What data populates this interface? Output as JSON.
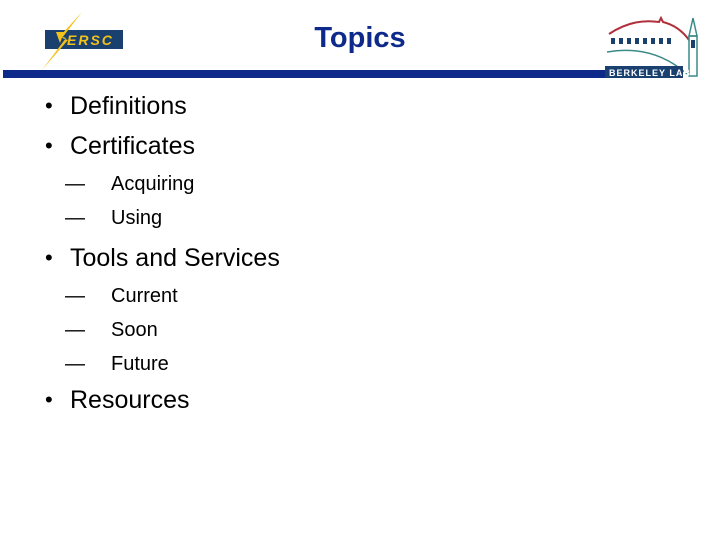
{
  "slide": {
    "title": "Topics",
    "logos": {
      "left": {
        "text": "ERSC",
        "name": "NERSC"
      },
      "right": {
        "text": "BERKELEY LAB",
        "name": "Berkeley Lab"
      }
    },
    "colors": {
      "title": "#0d2a8a",
      "bar": "#0d2a8a",
      "bolt": "#f2c21b",
      "logo_box": "#1a4070"
    },
    "outline": [
      {
        "bullet": "•",
        "text": "Definitions",
        "children": []
      },
      {
        "bullet": "•",
        "text": "Certificates",
        "children": [
          {
            "dash": "—",
            "text": "Acquiring"
          },
          {
            "dash": "—",
            "text": "Using"
          }
        ]
      },
      {
        "bullet": "•",
        "text": "Tools and Services",
        "children": [
          {
            "dash": "—",
            "text": "Current"
          },
          {
            "dash": "—",
            "text": "Soon"
          },
          {
            "dash": "—",
            "text": "Future"
          }
        ]
      },
      {
        "bullet": "•",
        "text": "Resources",
        "children": []
      }
    ]
  }
}
